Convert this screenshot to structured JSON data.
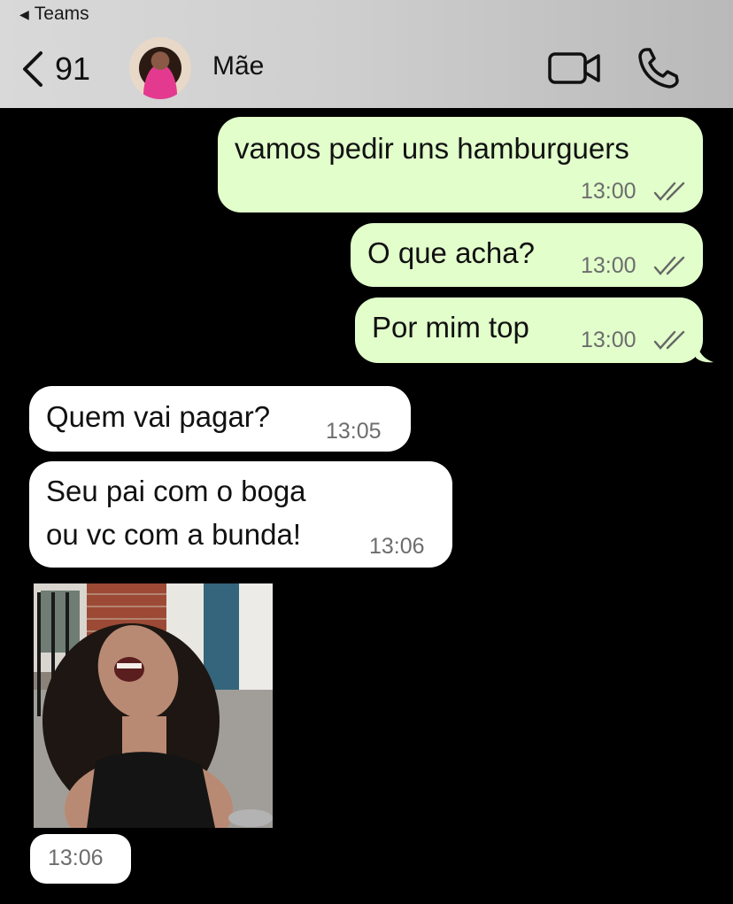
{
  "status_bar": {
    "back_app": "Teams"
  },
  "header": {
    "unread_count": "91",
    "contact_name": "Mãe",
    "video_icon": "video-camera-icon",
    "phone_icon": "phone-icon"
  },
  "colors": {
    "outgoing_bubble": "#e1fecb",
    "incoming_bubble": "#ffffff",
    "background": "#000000",
    "header_bg": "#cfcfcf"
  },
  "messages": [
    {
      "text": "vamos pedir uns hamburguers",
      "time": "13:00",
      "direction": "out",
      "status_icon": "double-check-icon"
    },
    {
      "text": "O que acha?",
      "time": "13:00",
      "direction": "out",
      "status_icon": "double-check-icon"
    },
    {
      "text": "Por mim top",
      "time": "13:00",
      "direction": "out",
      "status_icon": "double-check-icon"
    },
    {
      "text": "Quem vai pagar?",
      "time": "13:05",
      "direction": "in"
    },
    {
      "line1": "Seu pai com o boga",
      "line2": "ou vc com a bunda!",
      "time": "13:06",
      "direction": "in"
    },
    {
      "type": "image",
      "time": "13:06",
      "direction": "in"
    }
  ]
}
